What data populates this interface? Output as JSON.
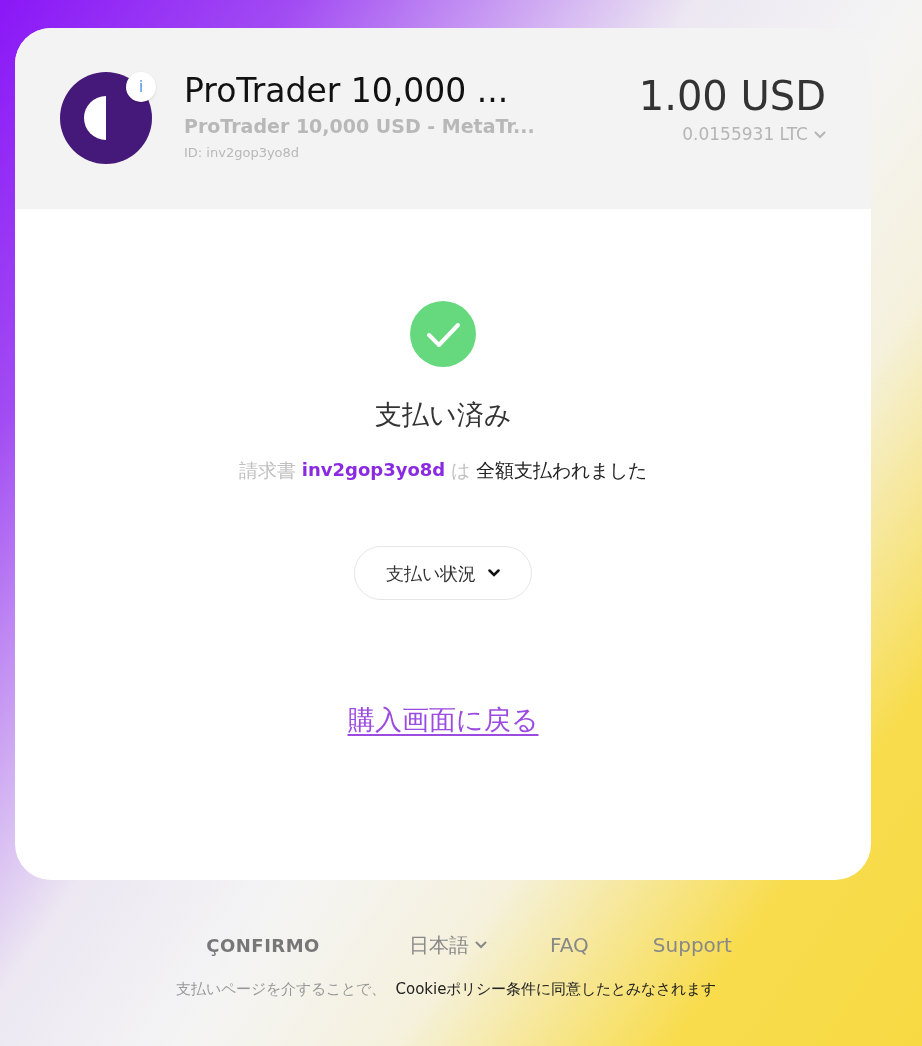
{
  "header": {
    "title": "ProTrader 10,000 ...",
    "subtitle": "ProTrader 10,000 USD - MetaTr...",
    "id_line": "ID: inv2gop3yo8d",
    "info_badge": "i",
    "amount": "1.00 USD",
    "crypto_amount": "0.0155931 LTC"
  },
  "status": {
    "paid": true,
    "title": "支払い済み",
    "message": {
      "prefix": "請求書",
      "invoice_id": "inv2gop3yo8d",
      "particle": "は",
      "suffix": "全額支払われました"
    }
  },
  "payment_status_button": {
    "label": "支払い状況",
    "expanded": false
  },
  "return_link": "購入画面に戻る",
  "footer": {
    "logo": "ÇONFIRMO",
    "language": "日本語",
    "links": [
      "FAQ",
      "Support"
    ],
    "consent_prefix": "支払いページを介することで、",
    "consent_link": "Cookieポリシー条件に同意したとみなされます"
  }
}
